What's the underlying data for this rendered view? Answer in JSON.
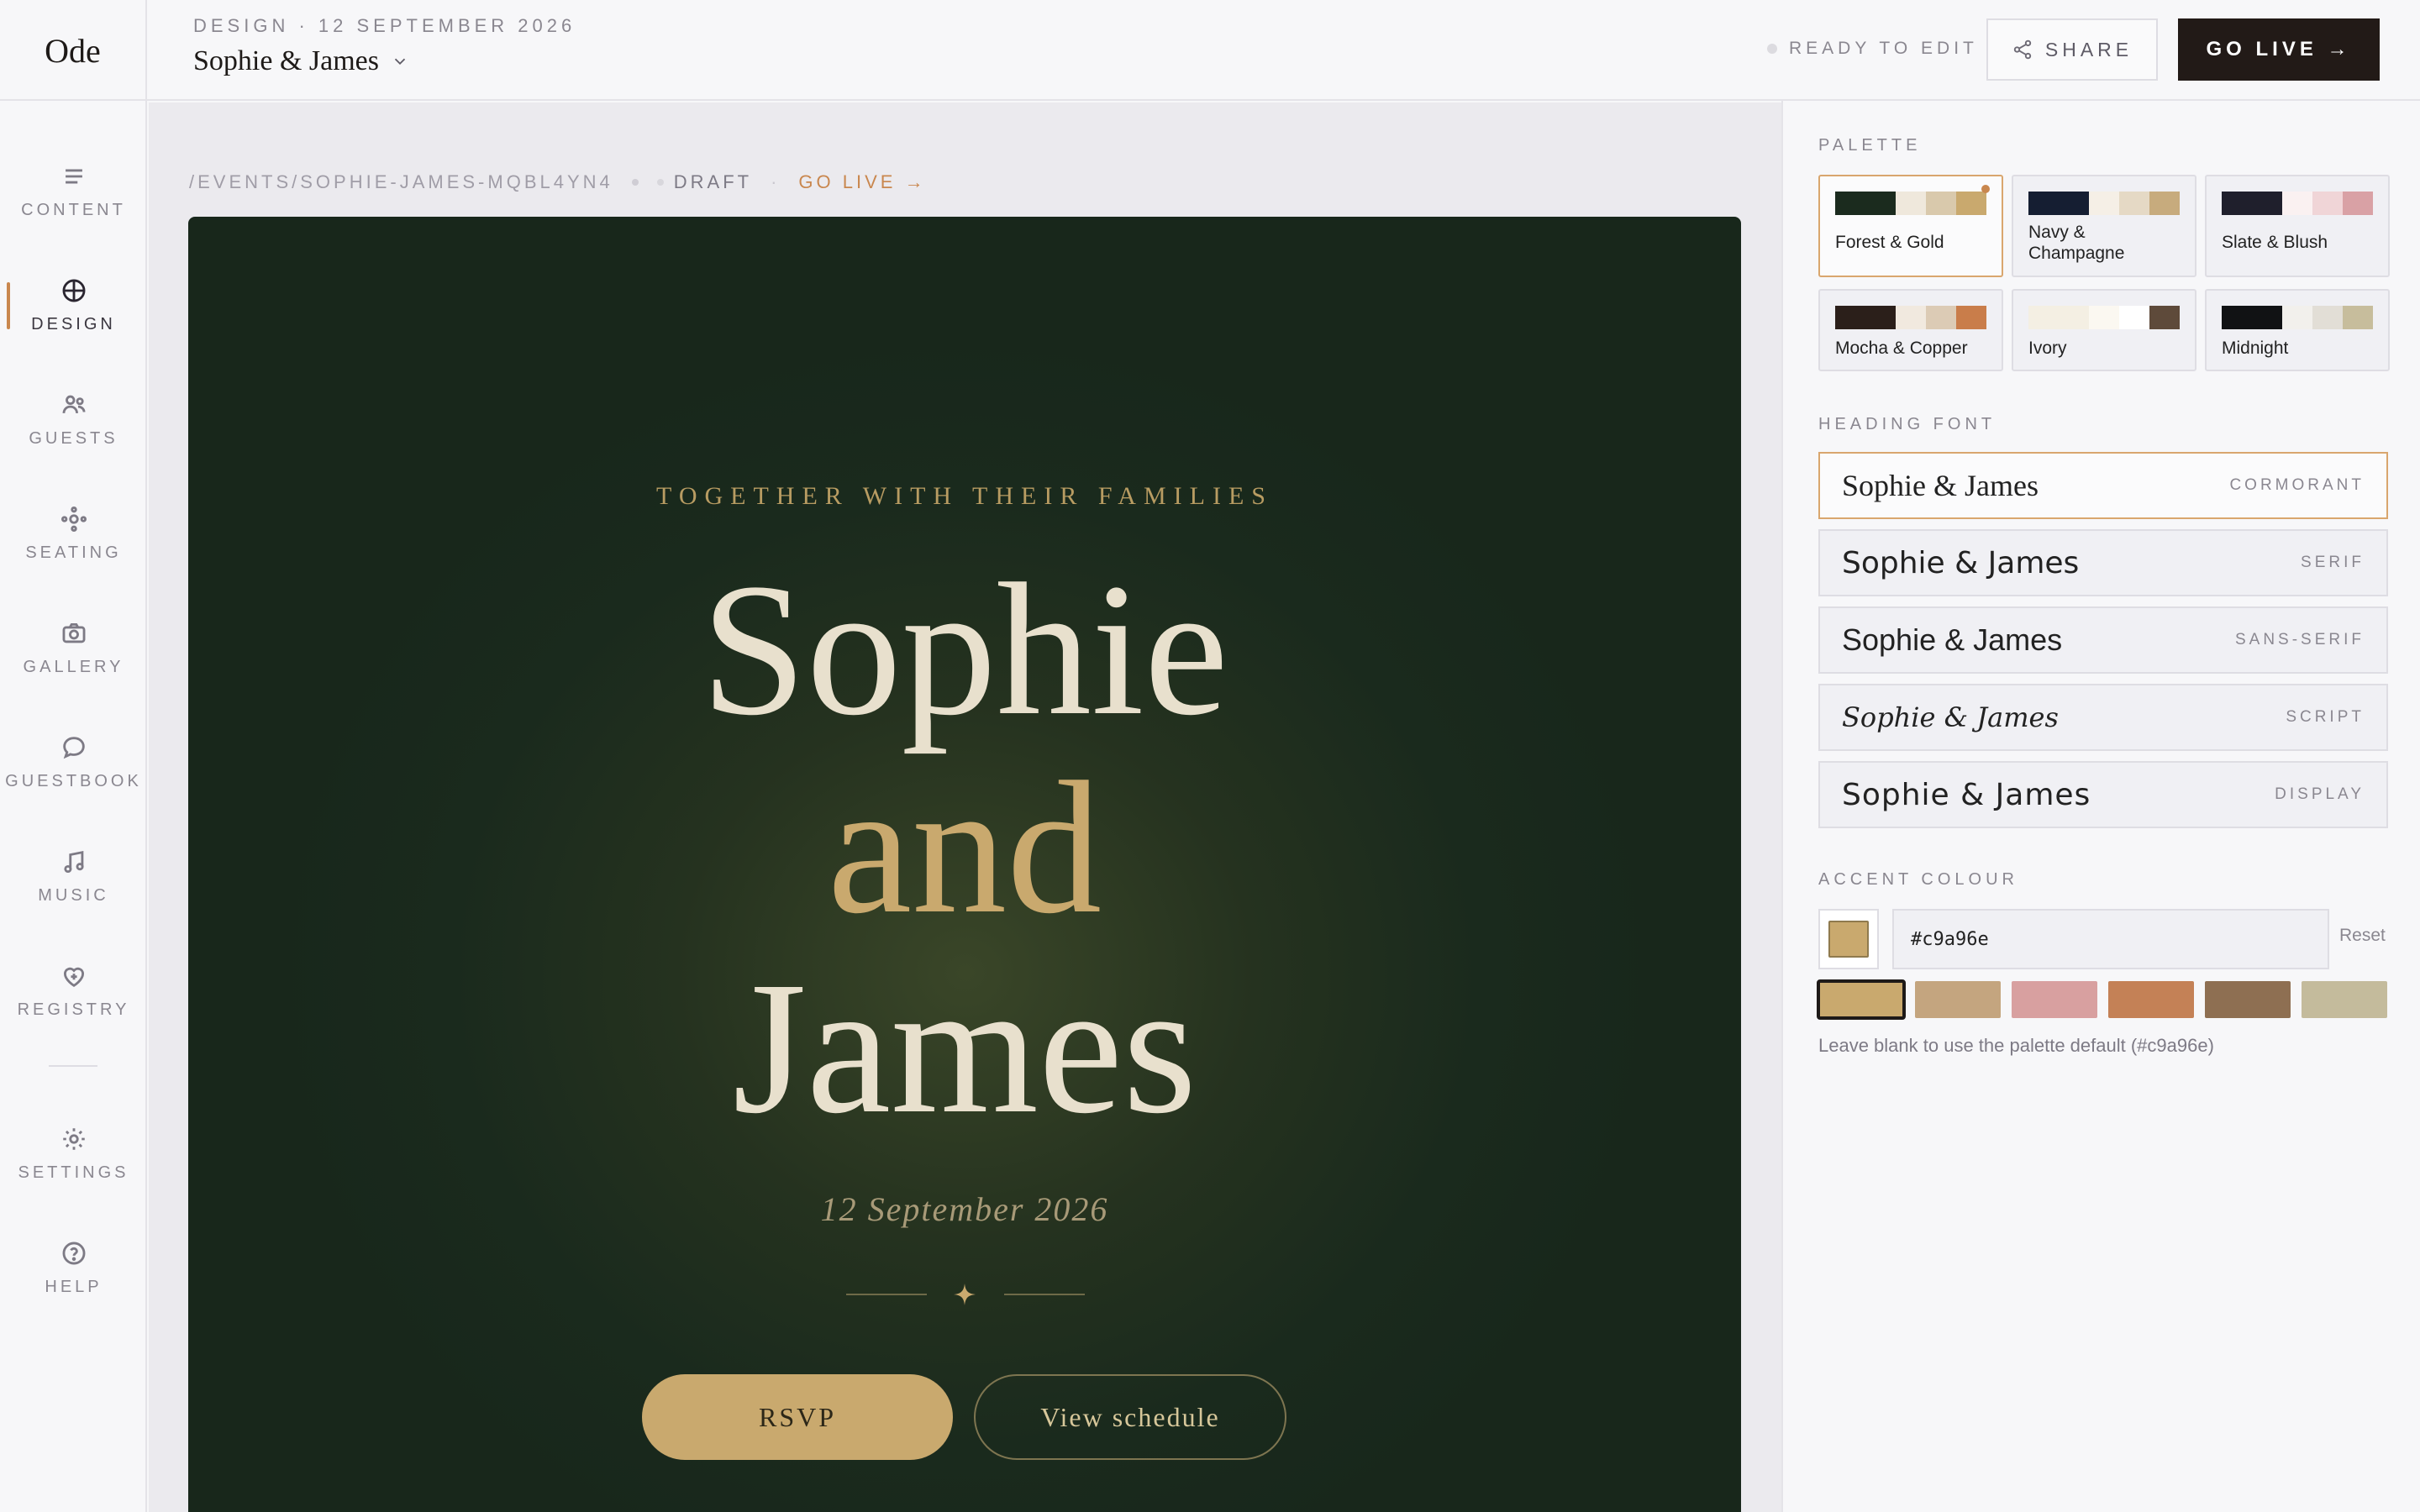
{
  "app": {
    "logo": "Ode"
  },
  "header": {
    "crumb": "DESIGN · 12 SEPTEMBER 2026",
    "event_name": "Sophie & James",
    "status": "READY TO EDIT",
    "share_label": "SHARE",
    "golive_label": "GO LIVE →"
  },
  "sidebar": {
    "items": [
      {
        "label": "CONTENT",
        "icon": "lines-icon"
      },
      {
        "label": "DESIGN",
        "icon": "compass-icon",
        "active": true
      },
      {
        "label": "GUESTS",
        "icon": "people-icon"
      },
      {
        "label": "SEATING",
        "icon": "seating-icon"
      },
      {
        "label": "GALLERY",
        "icon": "camera-icon"
      },
      {
        "label": "GUESTBOOK",
        "icon": "chat-bubble-icon"
      },
      {
        "label": "MUSIC",
        "icon": "music-note-icon"
      },
      {
        "label": "REGISTRY",
        "icon": "heart-icon"
      },
      {
        "label": "SETTINGS",
        "icon": "sun-gear-icon"
      },
      {
        "label": "HELP",
        "icon": "question-icon"
      }
    ]
  },
  "canvas": {
    "path": "/EVENTS/SOPHIE-JAMES-MQBL4YN4",
    "draft": "DRAFT",
    "golive": "GO LIVE →"
  },
  "preview": {
    "together": "TOGETHER WITH THEIR FAMILIES",
    "name1": "Sophie",
    "joiner": "and",
    "name2": "James",
    "date": "12 September 2026",
    "rsvp": "RSVP",
    "schedule": "View schedule"
  },
  "panel": {
    "palette_label": "PALETTE",
    "palettes": [
      {
        "name": "Forest & Gold",
        "colors": [
          "#1b2b1e",
          "#efe8dc",
          "#d9c9ac",
          "#c9a96e"
        ],
        "selected": true
      },
      {
        "name": "Navy & Champagne",
        "colors": [
          "#151e32",
          "#f5efe6",
          "#e5d9c5",
          "#c7ab7d"
        ]
      },
      {
        "name": "Slate & Blush",
        "colors": [
          "#1f1f2c",
          "#faf1f1",
          "#f0d5d7",
          "#d9a1a5"
        ]
      },
      {
        "name": "Mocha & Copper",
        "colors": [
          "#2b1f1a",
          "#f1e9df",
          "#dccbb5",
          "#c97d4a"
        ]
      },
      {
        "name": "Ivory",
        "colors": [
          "#f4efe3",
          "#fbf8f1",
          "#ffffff",
          "#5e4a3a"
        ]
      },
      {
        "name": "Midnight",
        "colors": [
          "#111214",
          "#f2f0ec",
          "#e2ded6",
          "#c7bd9c"
        ]
      }
    ],
    "font_label": "HEADING FONT",
    "fonts": [
      {
        "sample": "Sophie & James",
        "tag": "CORMORANT",
        "selected": true
      },
      {
        "sample": "Sophie & James",
        "tag": "SERIF"
      },
      {
        "sample": "Sophie & James",
        "tag": "SANS-SERIF"
      },
      {
        "sample": "Sophie & James",
        "tag": "SCRIPT"
      },
      {
        "sample": "Sophie & James",
        "tag": "DISPLAY"
      }
    ],
    "accent_label": "ACCENT COLOUR",
    "accent_value": "#c9a96e",
    "reset": "Reset",
    "accent_swatches": [
      "#c9a96e",
      "#c4a57f",
      "#d8a0a0",
      "#c48156",
      "#8e6f52",
      "#c4bb9c"
    ],
    "hint": "Leave blank to use the palette default (#c9a96e)"
  }
}
